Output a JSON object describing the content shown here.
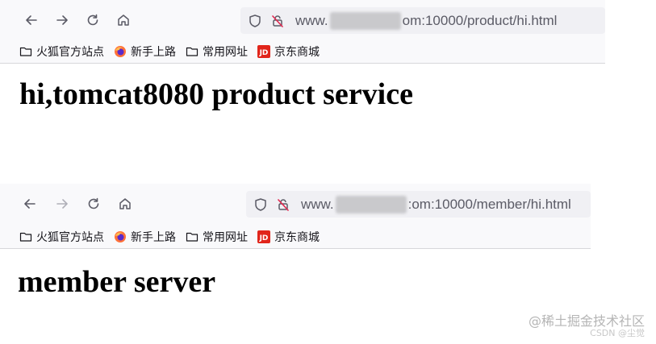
{
  "browser1": {
    "url": {
      "prefix": "www.",
      "suffix": "om:10000/product/hi.html"
    },
    "bookmarks": [
      {
        "label": "火狐官方站点",
        "icon": "folder-icon"
      },
      {
        "label": "新手上路",
        "icon": "firefox-icon"
      },
      {
        "label": "常用网址",
        "icon": "folder-icon"
      },
      {
        "label": "京东商城",
        "icon": "jd-icon"
      }
    ],
    "page_heading": "hi,tomcat8080 product service"
  },
  "browser2": {
    "url": {
      "prefix": "www.",
      "suffix": ":om:10000/member/hi.html"
    },
    "bookmarks": [
      {
        "label": "火狐官方站点",
        "icon": "folder-icon"
      },
      {
        "label": "新手上路",
        "icon": "firefox-icon"
      },
      {
        "label": "常用网址",
        "icon": "folder-icon"
      },
      {
        "label": "京东商城",
        "icon": "jd-icon"
      }
    ],
    "page_heading": "member server"
  },
  "watermark": {
    "main": "@稀土掘金技术社区",
    "sub": "CSDN @尘觉"
  },
  "colors": {
    "toolbar_bg": "#f9f9fb",
    "urlbar_bg": "#f0f0f4",
    "jd_red": "#e1251b",
    "firefox_orange": "#ff7139"
  }
}
